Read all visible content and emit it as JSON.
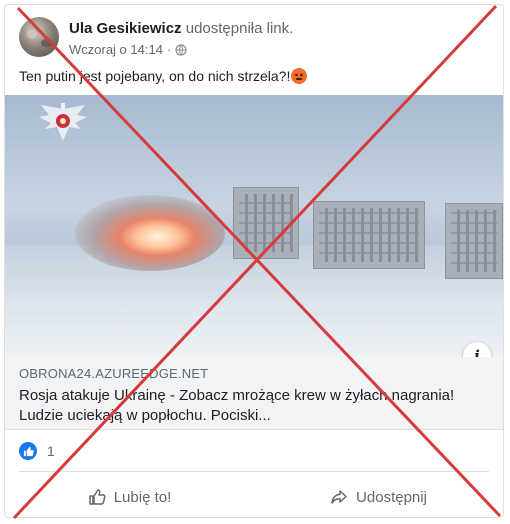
{
  "post": {
    "author": "Ula Gesikiewicz",
    "action": "udostępniła link.",
    "time": "Wczoraj o 14:14",
    "separator": "·",
    "text": "Ten putin jest pojebany, on do nich strzela?!",
    "emoji_icon": "angry-face-emoji"
  },
  "link_preview": {
    "domain": "OBRONA24.AZUREEDGE.NET",
    "headline": "Rosja atakuje Ukrainę - Zobacz mrożące krew w żyłach nagrania! Ludzie uciekają w popłochu. Pociski..."
  },
  "reactions": {
    "count": "1",
    "icon": "like-icon"
  },
  "actions": {
    "like_label": "Lubię to!",
    "share_label": "Udostępnij"
  },
  "overlay": {
    "type": "red-x-cross",
    "color": "#d63a3a"
  }
}
